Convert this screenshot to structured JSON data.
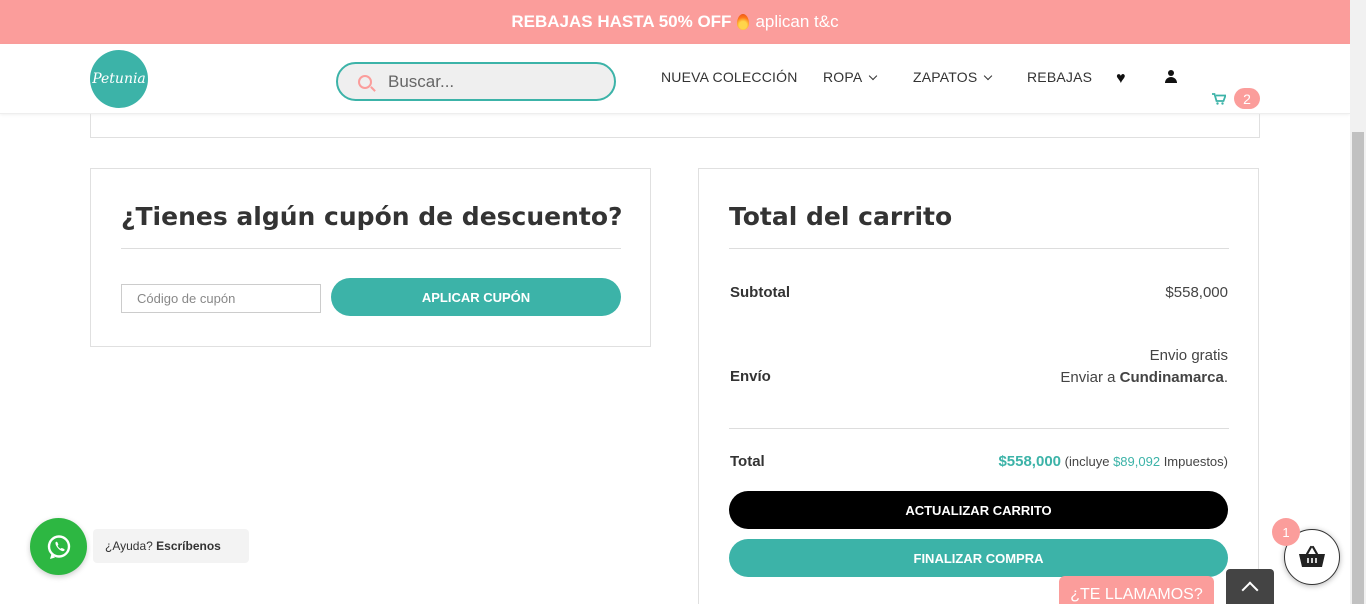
{
  "promo": {
    "bold_text": "REBAJAS HASTA 50% OFF",
    "rest_text": "aplican t&c"
  },
  "header": {
    "logo_text": "Petunia",
    "search_placeholder": "Buscar...",
    "nav": [
      "NUEVA COLECCIÓN",
      "ROPA",
      "ZAPATOS",
      "REBAJAS"
    ],
    "cart_count": "2"
  },
  "coupon": {
    "title": "¿Tienes algún cupón de descuento?",
    "input_placeholder": "Código de cupón",
    "apply_label": "APLICAR CUPÓN"
  },
  "totals": {
    "title": "Total del carrito",
    "subtotal_label": "Subtotal",
    "subtotal_value": "$558,000",
    "shipping_label": "Envío",
    "shipping_method": "Envio gratis",
    "shipping_to_prefix": "Enviar a",
    "shipping_to_place": "Cundinamarca",
    "shipping_to_suffix": ".",
    "total_label": "Total",
    "total_value": "$558,000",
    "tax_prefix": "(incluye",
    "tax_value": "$89,092",
    "tax_suffix": "Impuestos)",
    "update_label": "ACTUALIZAR CARRITO",
    "checkout_label": "FINALIZAR COMPRA"
  },
  "whatsapp": {
    "question": "¿Ayuda?",
    "action": "Escríbenos"
  },
  "callback_label": "¿TE LLAMAMOS?",
  "basket_count": "1",
  "colors": {
    "teal": "#3cb3a8",
    "pink": "#fb9d9b",
    "whatsapp": "#2db742"
  }
}
